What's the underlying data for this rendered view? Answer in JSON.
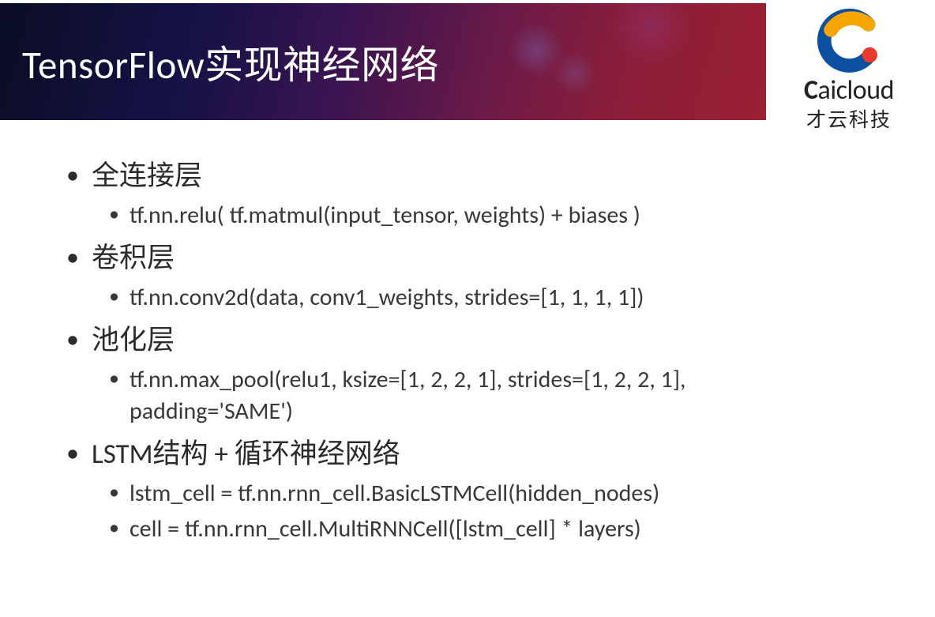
{
  "header": {
    "title": "TensorFlow实现神经网络"
  },
  "logo": {
    "brand_en_bold": "C",
    "brand_en_rest": "aicloud",
    "brand_cn": "才云科技"
  },
  "bullets": [
    {
      "label": "全连接层",
      "children": [
        "tf.nn.relu( tf.matmul(input_tensor, weights) + biases )"
      ]
    },
    {
      "label": "卷积层",
      "children": [
        "tf.nn.conv2d(data, conv1_weights, strides=[1, 1, 1, 1])"
      ]
    },
    {
      "label": "池化层",
      "children": [
        "tf.nn.max_pool(relu1, ksize=[1, 2, 2, 1], strides=[1, 2, 2, 1], padding='SAME')"
      ]
    },
    {
      "label": "LSTM结构 + 循环神经网络",
      "children": [
        "lstm_cell = tf.nn.rnn_cell.BasicLSTMCell(hidden_nodes)",
        "cell = tf.nn.rnn_cell.MultiRNNCell([lstm_cell] * layers)"
      ]
    }
  ]
}
